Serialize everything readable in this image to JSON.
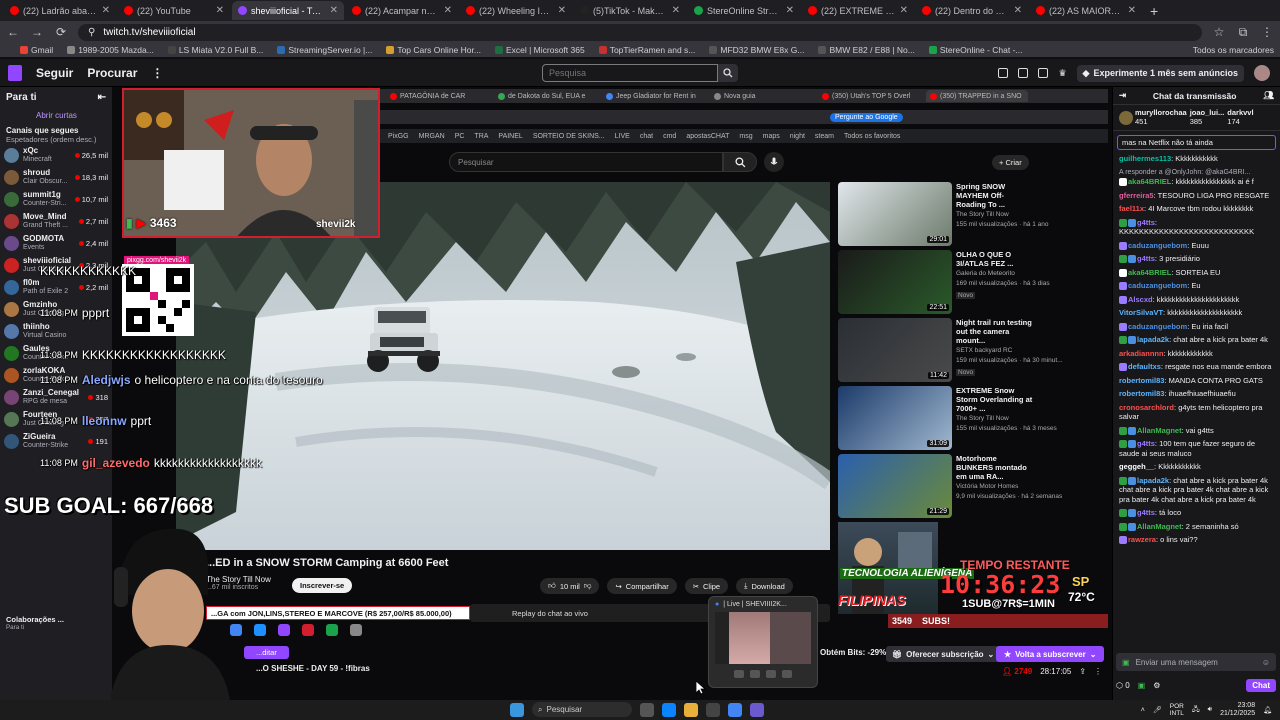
{
  "browser": {
    "tabs": [
      {
        "title": "(22) Ladrão abandona moto n",
        "color": "#ff0000"
      },
      {
        "title": "(22) YouTube",
        "color": "#ff0000"
      },
      {
        "title": "sheviiioficial - Twitch",
        "color": "#9147ff",
        "active": true
      },
      {
        "title": "(22) Acampar na neve forte c",
        "color": "#ff0000"
      },
      {
        "title": "(22) Wheeling Into a Swamp",
        "color": "#ff0000"
      },
      {
        "title": "(5)TikTok - Make Your Day",
        "color": "#222222"
      },
      {
        "title": "StereOnline Stream - Watch L",
        "color": "#1aa34a"
      },
      {
        "title": "(22) EXTREME BLIZZARD surv",
        "color": "#ff0000"
      },
      {
        "title": "(22) Dentro do Submundo Bra",
        "color": "#ff0000"
      },
      {
        "title": "(22) AS MAIORES QUEDAS DE",
        "color": "#ff0000"
      }
    ],
    "new_tab": "+",
    "url": "twitch.tv/sheviiioficial",
    "bookmarks": [
      {
        "label": "Gmail",
        "color": "#ea4335"
      },
      {
        "label": "1989-2005 Mazda...",
        "color": "#888888"
      },
      {
        "label": "LS Miata V2.0 Full B...",
        "color": "#444444"
      },
      {
        "label": "StreamingServer.io |...",
        "color": "#2b6cb0"
      },
      {
        "label": "Top Cars Online Hor...",
        "color": "#d69e2e"
      },
      {
        "label": "Excel | Microsoft 365",
        "color": "#1d6f42"
      },
      {
        "label": "TopTierRamen and s...",
        "color": "#c53030"
      },
      {
        "label": "MFD32 BMW E8x G...",
        "color": "#555555"
      },
      {
        "label": "BMW E82 / E88 | No...",
        "color": "#555555"
      },
      {
        "label": "StereOnline - Chat -...",
        "color": "#1aa34a"
      }
    ],
    "all_bookmarks": "Todos os marcadores"
  },
  "twitch_nav": {
    "follow": "Seguir",
    "browse": "Procurar",
    "search_placeholder": "Pesquisa",
    "prime_label": "Experimente 1 mês sem anúncios"
  },
  "sidebar": {
    "title": "Para ti",
    "open_tabs": "Abrir curtas",
    "followed_title": "Canais que segues",
    "followed_sub": "Espetadores (ordem desc.)",
    "channels": [
      {
        "name": "xQc",
        "game": "Minecraft",
        "viewers": "26,5 mil",
        "color": "#5a7d9a"
      },
      {
        "name": "shroud",
        "game": "Clair Obscur...",
        "viewers": "18,3 mil",
        "color": "#7b5a3a"
      },
      {
        "name": "summit1g",
        "game": "Counter-Stri...",
        "viewers": "10,7 mil",
        "color": "#3a6a3a"
      },
      {
        "name": "Move_Mind",
        "game": "Grand Theft ...",
        "viewers": "2,7 mil",
        "color": "#aa3333"
      },
      {
        "name": "GODMOTA",
        "game": "Events",
        "viewers": "2,4 mil",
        "color": "#6a4a8a"
      },
      {
        "name": "sheviiioficial",
        "game": "Just Chatting",
        "viewers": "2,3 mil",
        "color": "#cc2222"
      },
      {
        "name": "fl0m",
        "game": "Path of Exile 2",
        "viewers": "2,2 mil",
        "color": "#336699"
      },
      {
        "name": "Gmzinho",
        "game": "Just Chatting",
        "viewers": "",
        "color": "#aa7744"
      },
      {
        "name": "thiinho",
        "game": "Virtual Casino",
        "viewers": "",
        "color": "#5577aa"
      },
      {
        "name": "Gaules",
        "game": "Counter-Strike",
        "viewers": "",
        "color": "#227722"
      },
      {
        "name": "zorlaKOKA",
        "game": "Counter-Strike",
        "viewers": "",
        "color": "#aa5522"
      },
      {
        "name": "Zanzi_Cenegal",
        "game": "RPG de mesa",
        "viewers": "318",
        "color": "#774477"
      },
      {
        "name": "Fourteen",
        "game": "Just Chatting",
        "viewers": "257",
        "color": "#557755"
      },
      {
        "name": "ZiGueira",
        "game": "Counter-Strike",
        "viewers": "191",
        "color": "#335577"
      }
    ],
    "collab_title": "Colaborações ...",
    "collab_sub": "Para ti"
  },
  "inner_browser": {
    "tabs": [
      {
        "title": "PATAGÔNIA de CAR",
        "color": "#ff0000"
      },
      {
        "title": "de Dakota do Sul, EUA e",
        "color": "#34a853"
      },
      {
        "title": "Jeep Gladiator for Rent in",
        "color": "#4285f4"
      },
      {
        "title": "Nova guia",
        "color": "#888888"
      },
      {
        "title": "(350) Utah's TOP 5 Overl",
        "color": "#ff0000"
      },
      {
        "title": "(350) TRAPPED in a SNO",
        "color": "#ff0000",
        "active": true
      }
    ],
    "google_button": "Pergunte ao Google",
    "bookmarks": [
      "PixGG",
      "MRGAN",
      "PC",
      "TRA",
      "PAINEL",
      "SORTEIO DE SKINS...",
      "LIVE",
      "chat",
      "cmd",
      "apostasCHAT",
      "msg",
      "maps",
      "night",
      "steam",
      "Todos os favoritos"
    ],
    "search_placeholder": "Pesquisar",
    "create_label": "+ Criar"
  },
  "youtube": {
    "title": "...ED in a SNOW STORM Camping at 6600 Feet",
    "channel": "The Story Till Now",
    "subscribers": "...67 mil inscritos",
    "subscribe": "Inscrever-se",
    "likes": "10 mil",
    "share": "Compartilhar",
    "clip": "Clipe",
    "download": "Download",
    "replay": "Replay do chat ao vivo",
    "recommendations": [
      {
        "title": "Spring SNOW MAYHEM Off-Roading To ...",
        "channel": "The Story Till Now",
        "meta": "155 mil visualizações · há 1 ano",
        "duration": "29:01",
        "badge": "",
        "c1": "#dfe6ea",
        "c2": "#6c7a6a"
      },
      {
        "title": "OLHA O QUE O 3I/ATLAS FEZ ...",
        "channel": "Galeria do Meteorito",
        "meta": "169 mil visualizações · há 3 dias",
        "duration": "22:51",
        "badge": "Novo",
        "c1": "#1a1a1a",
        "c2": "#2a5a2a"
      },
      {
        "title": "Night trail run testing out the camera mount...",
        "channel": "SETX backyard RC",
        "meta": "159 mil visualizações · há 30 minut...",
        "duration": "11:42",
        "badge": "Novo",
        "c1": "#2a2f35",
        "c2": "#4a4a4a"
      },
      {
        "title": "EXTREME Snow Storm Overlanding at 7000+ ...",
        "channel": "The Story Till Now",
        "meta": "155 mil visualizações · há 3 meses",
        "duration": "31:09",
        "badge": "",
        "c1": "#1c3b6a",
        "c2": "#a0b8d0"
      },
      {
        "title": "Motorhome BUNKERS montado em uma RA...",
        "channel": "Victória Motor Homes",
        "meta": "9,9 mil visualizações · há 2 semanas",
        "duration": "21:29",
        "badge": "",
        "c1": "#2b5fae",
        "c2": "#6b8a3a"
      }
    ]
  },
  "overlay": {
    "cam_count": "3463",
    "cam_name": "shevii2k",
    "pix_url": "pixgg.com/shevii2k",
    "sub_goal": "SUB GOAL: 667/668",
    "chat_lines": [
      {
        "time": "",
        "name": "",
        "text": "KKKKKKKKKKKK",
        "color": "#ffffff"
      },
      {
        "time": "11:08 PM",
        "name": "",
        "text": "ppprt",
        "color": "#ffffff"
      },
      {
        "time": "11:08 PM",
        "name": "",
        "text": "KKKKKKKKKKKKKKKKKK",
        "color": "#ffffff"
      },
      {
        "time": "11:08 PM",
        "name": "Aledjwjs",
        "text": "o helicoptero e na conta do tesouro",
        "color": "#8aa7ff"
      },
      {
        "time": "11:08 PM",
        "name": "lleonnw",
        "text": "pprt",
        "color": "#8aa7ff"
      },
      {
        "time": "11:08 PM",
        "name": "gil_azevedo",
        "text": "kkkkkkkkkkkkkkkkkk",
        "color": "#ff6b6b"
      }
    ],
    "tempo_label": "TEMPO RESTANTE",
    "timer": "10:36:23",
    "tempo_sub": "1SUB@7R$=1MIN",
    "sp_label": "SP",
    "temp_label": "72°C",
    "alien_text": "TECNOLOGIA ALIENÍGENA",
    "filipinas": "FILIPINAS",
    "donation": "...GA com JON,LINS,STEREO E MARCOVE (R$ 257,00/R$ 85.000,00)",
    "subs_count": "3549",
    "subs_label": "SUBS!",
    "bits_label": "...ditar",
    "song": "...O SHESHE - DAY 59 - !fibras"
  },
  "taskbar_preview": {
    "title": "| Live | SHEVIIII2K..."
  },
  "stream_info": {
    "bits": "Obtém Bits: -29%",
    "gift": "Oferecer subscrição",
    "resub": "Volta a subscrever",
    "viewers": "2749",
    "uptime": "28:17:05"
  },
  "chat": {
    "title": "Chat da transmissão",
    "pinned": [
      {
        "name": "muryllorochaa",
        "count": "451"
      },
      {
        "name": "joao_lui...",
        "count": "385"
      },
      {
        "name": "darkvvl",
        "count": "174"
      }
    ],
    "first": "mas na Netflix não tá ainda",
    "messages": [
      {
        "user": "guilhermes113",
        "color": "#00c4a7",
        "text": "Kkkkkkkkkkk",
        "reply": "",
        "badges": []
      },
      {
        "user": "aka64BRIEL",
        "color": "#3fb950",
        "text": "kkkkkkkkkkkkkkkk ai é f",
        "reply": "A responder a @OnlyJohn: @akaG4BRI...",
        "badges": [
          "#ffffff"
        ]
      },
      {
        "user": "gferreira5",
        "color": "#e05c9c",
        "text": "TESOURO LIGA PRO RESGATE",
        "reply": "",
        "badges": []
      },
      {
        "user": "fael11x",
        "color": "#ff4f4f",
        "text": "4I Marcove tbm rodou kkkkkkkk",
        "reply": "",
        "badges": []
      },
      {
        "user": "g4tts",
        "color": "#9b7bff",
        "text": "KKKKKKKKKKKKKKKKKKKKKKKKKKK",
        "reply": "",
        "badges": [
          "#2ea043",
          "#4a90e2"
        ]
      },
      {
        "user": "caduzanguebom",
        "color": "#4a90e2",
        "text": "Euuu",
        "reply": "",
        "badges": [
          "#9b7bff"
        ]
      },
      {
        "user": "g4tts",
        "color": "#9b7bff",
        "text": "3 presidiário",
        "reply": "",
        "badges": [
          "#2ea043",
          "#4a90e2"
        ]
      },
      {
        "user": "aka64BRIEL",
        "color": "#3fb950",
        "text": "SORTEIA EU",
        "reply": "",
        "badges": [
          "#ffffff"
        ]
      },
      {
        "user": "caduzanguebom",
        "color": "#4a90e2",
        "text": "Eu",
        "reply": "",
        "badges": [
          "#9b7bff"
        ]
      },
      {
        "user": "Alscxd",
        "color": "#9b7bff",
        "text": "kkkkkkkkkkkkkkkkkkkkkk",
        "reply": "",
        "badges": [
          "#9b7bff"
        ]
      },
      {
        "user": "VitorSilvaVT",
        "color": "#5cb6ff",
        "text": "kkkkkkkkkkkkkkkkkkkk",
        "reply": "",
        "badges": []
      },
      {
        "user": "caduzanguebom",
        "color": "#4a90e2",
        "text": "Eu iria facil",
        "reply": "",
        "badges": [
          "#9b7bff"
        ]
      },
      {
        "user": "lapada2k",
        "color": "#5cb6ff",
        "text": "chat abre a kick pra bater 4k",
        "reply": "",
        "badges": [
          "#2ea043",
          "#4a90e2"
        ]
      },
      {
        "user": "arkadiannnn",
        "color": "#ff4f4f",
        "text": "kkkkkkkkkkkk",
        "reply": "",
        "badges": []
      },
      {
        "user": "defaultxs",
        "color": "#5cb6ff",
        "text": "resgate nos eua mande embora",
        "reply": "",
        "badges": [
          "#9b7bff"
        ]
      },
      {
        "user": "robertomil83",
        "color": "#5cb6ff",
        "text": "MANDA CONTA PRO GATS",
        "reply": "",
        "badges": []
      },
      {
        "user": "robertomil83",
        "color": "#5cb6ff",
        "text": "ihuaefhiuaefhiuaefiu",
        "reply": "",
        "badges": []
      },
      {
        "user": "cronosarchlord",
        "color": "#ff4f4f",
        "text": "g4yts tem helicoptero pra salvar",
        "reply": "",
        "badges": []
      },
      {
        "user": "AllanMagnet",
        "color": "#3fb950",
        "text": "vai g4tts",
        "reply": "",
        "badges": [
          "#2ea043",
          "#4a90e2"
        ]
      },
      {
        "user": "g4tts",
        "color": "#9b7bff",
        "text": "100 tem que fazer seguro de saude ai seus maluco",
        "reply": "",
        "badges": [
          "#2ea043",
          "#4a90e2"
        ]
      },
      {
        "user": "geggeh__",
        "color": "#ffffff",
        "text": "Kkkkkkkkkkk",
        "reply": "",
        "badges": []
      },
      {
        "user": "lapada2k",
        "color": "#5cb6ff",
        "text": "chat abre a kick pra bater 4k chat abre a kick pra bater 4k chat abre a kick pra bater 4k chat abre a kick pra bater 4k",
        "reply": "",
        "badges": [
          "#2ea043",
          "#4a90e2"
        ]
      },
      {
        "user": "g4tts",
        "color": "#9b7bff",
        "text": "tá loco",
        "reply": "",
        "badges": [
          "#2ea043",
          "#4a90e2"
        ]
      },
      {
        "user": "AllanMagnet",
        "color": "#3fb950",
        "text": "2 semaninha só",
        "reply": "",
        "badges": [
          "#2ea043",
          "#4a90e2"
        ]
      },
      {
        "user": "rawzera",
        "color": "#ff4f4f",
        "text": "o lins vai??",
        "reply": "",
        "badges": [
          "#9b7bff"
        ]
      }
    ],
    "input_placeholder": "Enviar uma mensagem",
    "points": "0",
    "chat_button": "Chat"
  },
  "taskbar": {
    "search": "Pesquisar",
    "lang_top": "POR",
    "lang_bottom": "INTL",
    "time": "23:08",
    "date": "21/12/2025"
  }
}
